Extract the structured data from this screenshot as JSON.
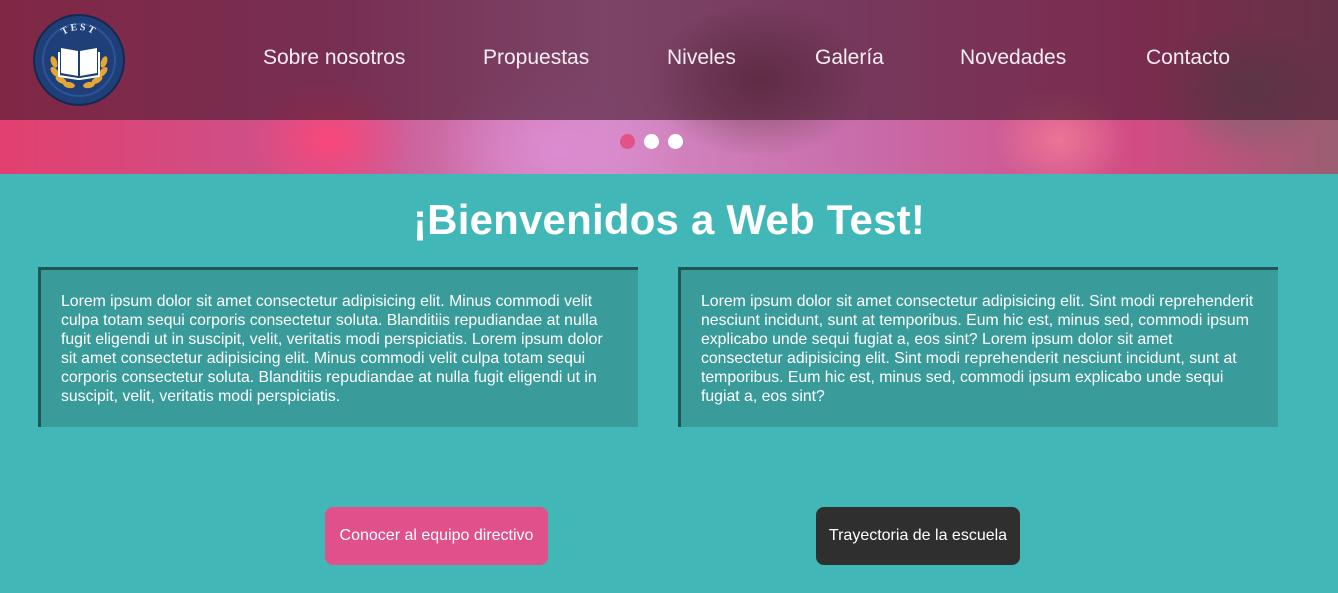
{
  "header": {
    "logo": {
      "icon": "open-book-icon",
      "emblem_text": "TEST",
      "colors": {
        "ring": "#1f3f78",
        "laurel": "#e8a531",
        "book": "#ffffff"
      }
    },
    "nav": [
      {
        "label": "Sobre nosotros"
      },
      {
        "label": "Propuestas"
      },
      {
        "label": "Niveles"
      },
      {
        "label": "Galería"
      },
      {
        "label": "Novedades"
      },
      {
        "label": "Contacto"
      }
    ],
    "carousel": {
      "slides": 3,
      "active_index": 0,
      "colors": {
        "active": "#e25286",
        "inactive": "#ffffff"
      }
    }
  },
  "main": {
    "title": "¡Bienvenidos a Web Test!",
    "cards": [
      {
        "text": "Lorem ipsum dolor sit amet consectetur adipisicing elit. Minus commodi velit culpa totam sequi corporis consectetur soluta. Blanditiis repudiandae at nulla fugit eligendi ut in suscipit, velit, veritatis modi perspiciatis. Lorem ipsum dolor sit amet consectetur adipisicing elit. Minus commodi velit culpa totam sequi corporis consectetur soluta. Blanditiis repudiandae at nulla fugit eligendi ut in suscipit, velit, veritatis modi perspiciatis."
      },
      {
        "text": "Lorem ipsum dolor sit amet consectetur adipisicing elit. Sint modi reprehenderit nesciunt incidunt, sunt at temporibus. Eum hic est, minus sed, commodi ipsum explicabo unde sequi fugiat a, eos sint? Lorem ipsum dolor sit amet consectetur adipisicing elit. Sint modi reprehenderit nesciunt incidunt, sunt at temporibus. Eum hic est, minus sed, commodi ipsum explicabo unde sequi fugiat a, eos sint?"
      }
    ],
    "buttons": [
      {
        "label": "Conocer al equipo directivo",
        "color": "#e0508b"
      },
      {
        "label": "Trayectoria de la escuela",
        "color": "#2f2f2f"
      }
    ]
  },
  "colors": {
    "page_background": "#42b7b7",
    "card_background": "#399c9a",
    "card_border": "#1f5756"
  }
}
